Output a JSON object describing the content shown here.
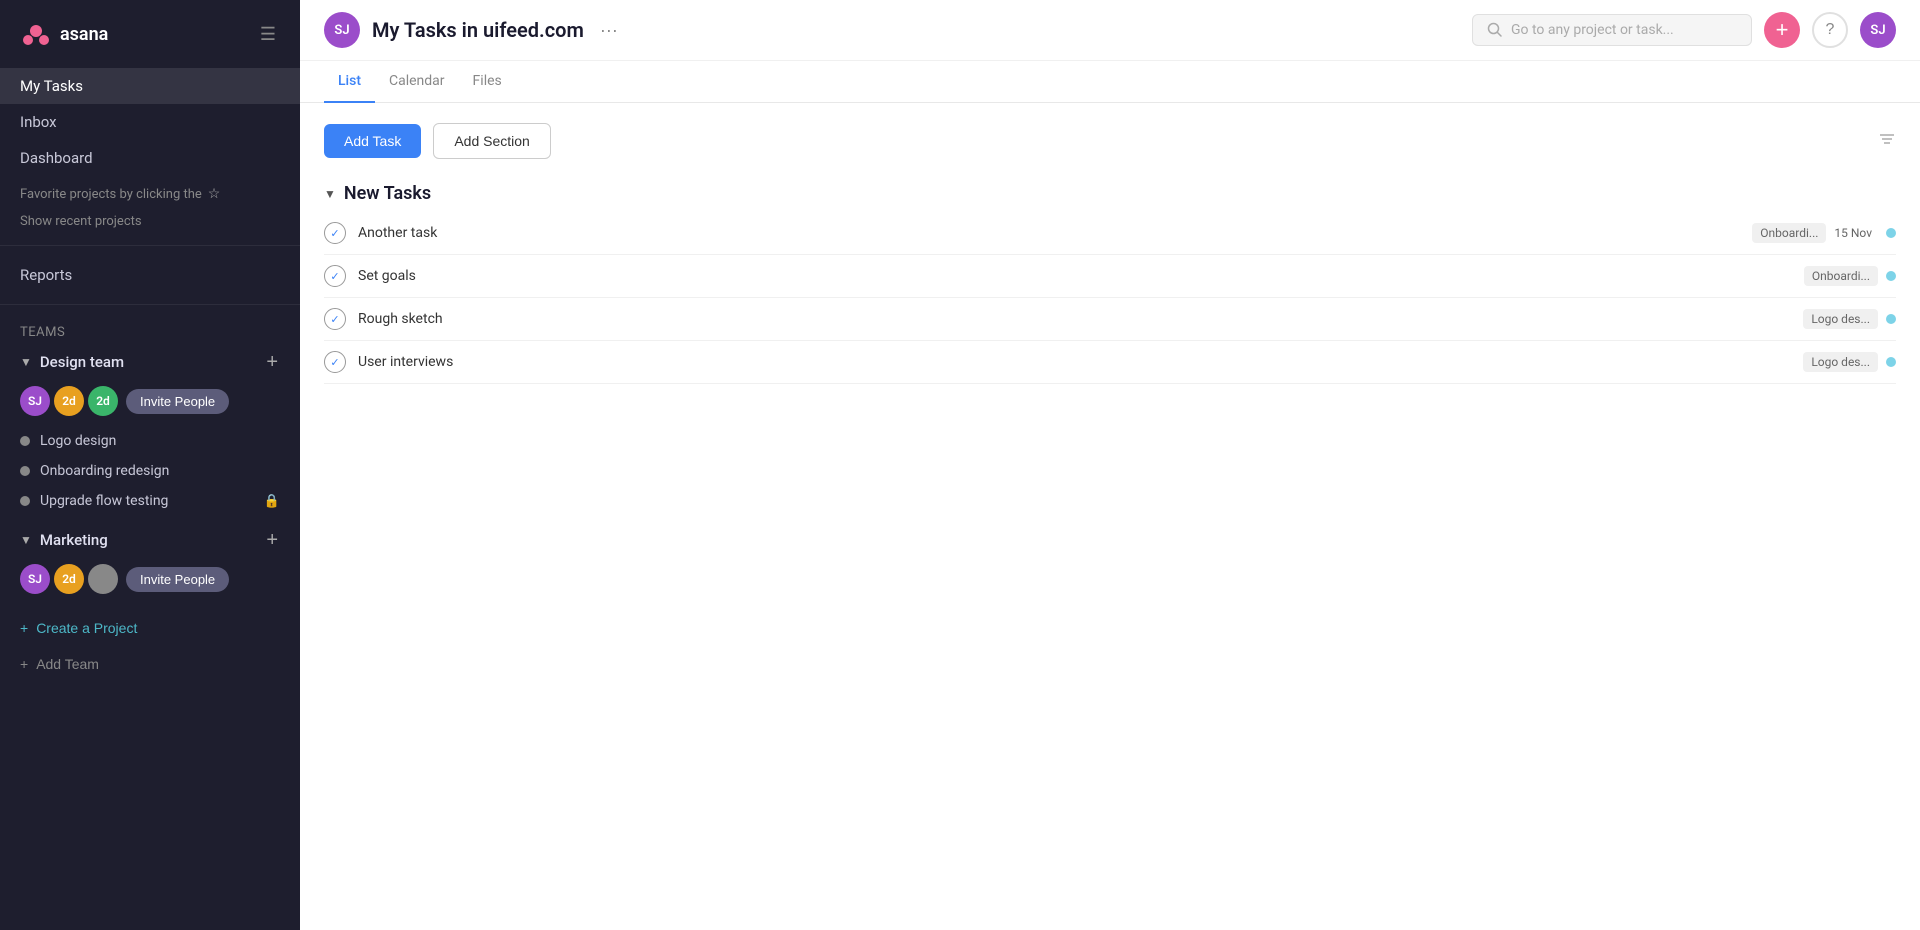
{
  "sidebar": {
    "logo_text": "asana",
    "nav": [
      {
        "label": "My Tasks",
        "active": true
      },
      {
        "label": "Inbox"
      },
      {
        "label": "Dashboard"
      }
    ],
    "hint": "Favorite projects by clicking the",
    "hint_star": "☆",
    "show_recent": "Show recent projects",
    "reports": "Reports",
    "teams_label": "Teams",
    "teams": [
      {
        "name": "Design team",
        "expanded": true,
        "members": [
          {
            "initials": "SJ",
            "color": "#9b4dca"
          },
          {
            "initials": "2d",
            "color": "#e8a020"
          },
          {
            "initials": "2d",
            "color": "#3ab56a"
          }
        ],
        "invite_label": "Invite People",
        "projects": [
          {
            "name": "Logo design",
            "dot_color": "#888",
            "locked": false
          },
          {
            "name": "Onboarding redesign",
            "dot_color": "#888",
            "locked": false
          },
          {
            "name": "Upgrade flow testing",
            "dot_color": "#888",
            "locked": true
          }
        ]
      },
      {
        "name": "Marketing",
        "expanded": true,
        "members": [
          {
            "initials": "SJ",
            "color": "#9b4dca"
          },
          {
            "initials": "2d",
            "color": "#e8a020"
          },
          {
            "initials": "",
            "color": "#888"
          }
        ],
        "invite_label": "Invite People",
        "projects": []
      }
    ],
    "create_project": "Create a Project",
    "add_team": "Add Team"
  },
  "topbar": {
    "page_avatar_initials": "SJ",
    "page_title": "My Tasks in uifeed.com",
    "more_icon": "···",
    "search_placeholder": "Go to any project or task...",
    "add_icon": "+",
    "help_icon": "?",
    "user_initials": "SJ"
  },
  "tabs": [
    {
      "label": "List",
      "active": true
    },
    {
      "label": "Calendar"
    },
    {
      "label": "Files"
    }
  ],
  "toolbar": {
    "add_task_label": "Add Task",
    "add_section_label": "Add Section"
  },
  "tasks_section": {
    "title": "New Tasks",
    "tasks": [
      {
        "name": "Another task",
        "tag": "Onboardi...",
        "date": "15 Nov",
        "dot_color": "#7dd3e8"
      },
      {
        "name": "Set goals",
        "tag": "Onboardi...",
        "date": "",
        "dot_color": "#7dd3e8"
      },
      {
        "name": "Rough sketch",
        "tag": "Logo des...",
        "date": "",
        "dot_color": "#7dd3e8"
      },
      {
        "name": "User interviews",
        "tag": "Logo des...",
        "date": "",
        "dot_color": "#7dd3e8"
      }
    ]
  }
}
